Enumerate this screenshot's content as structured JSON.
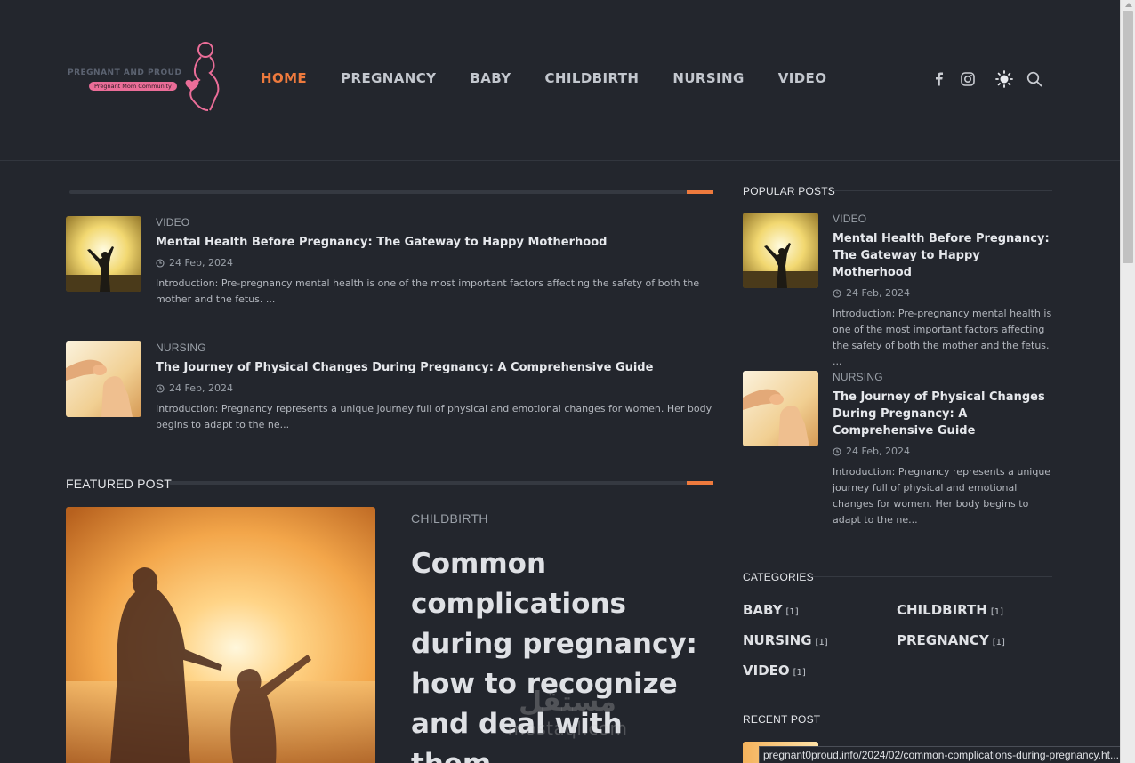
{
  "brand": {
    "name": "PREGNANT AND PROUD",
    "tagline": "Pregnant Mom Community",
    "accent": "#ee7a3d",
    "pink": "#ea6d98"
  },
  "nav": {
    "items": [
      "HOME",
      "PREGNANCY",
      "BABY",
      "CHILDBIRTH",
      "NURSING",
      "VIDEO"
    ],
    "active": "HOME"
  },
  "header_icons": [
    "facebook-icon",
    "instagram-icon",
    "theme-toggle-icon",
    "search-icon"
  ],
  "latest": [
    {
      "category": "VIDEO",
      "title": "Mental Health Before Pregnancy: The Gateway to Happy Motherhood",
      "date": "24 Feb, 2024",
      "excerpt": "Introduction: Pre-pregnancy mental health is one of the most important factors affecting the safety of both the mother and the fetus. ..."
    },
    {
      "category": "NURSING",
      "title": "The Journey of Physical Changes During Pregnancy: A Comprehensive Guide",
      "date": "24 Feb, 2024",
      "excerpt": "Introduction: Pregnancy represents a unique journey full of physical and emotional changes for women. Her body begins to adapt to the ne..."
    }
  ],
  "featured": {
    "section_title": "FEATURED POST",
    "category": "CHILDBIRTH",
    "title": "Common complications during pregnancy: how to recognize and deal with them"
  },
  "watermark": {
    "line1": "مستقل",
    "line2": "mostaql.com"
  },
  "sidebar": {
    "popular_title": "POPULAR POSTS",
    "popular": [
      {
        "category": "VIDEO",
        "title": "Mental Health Before Pregnancy: The Gateway to Happy Motherhood",
        "date": "24 Feb, 2024",
        "excerpt": "Introduction: Pre-pregnancy mental health is one of the most important factors affecting the safety of both the mother and the fetus. ..."
      },
      {
        "category": "NURSING",
        "title": "The Journey of Physical Changes During Pregnancy: A Comprehensive Guide",
        "date": "24 Feb, 2024",
        "excerpt": "Introduction: Pregnancy represents a unique journey full of physical and emotional changes for women. Her body begins to adapt to the ne..."
      }
    ],
    "categories_title": "CATEGORIES",
    "categories": [
      {
        "name": "BABY",
        "count": "[1]"
      },
      {
        "name": "CHILDBIRTH",
        "count": "[1]"
      },
      {
        "name": "NURSING",
        "count": "[1]"
      },
      {
        "name": "PREGNANCY",
        "count": "[1]"
      },
      {
        "name": "VIDEO",
        "count": "[1]"
      }
    ],
    "recent_title": "RECENT POST"
  },
  "status_bar": {
    "url": "pregnant0proud.info/2024/02/common-complications-during-pregnancy.ht..."
  }
}
